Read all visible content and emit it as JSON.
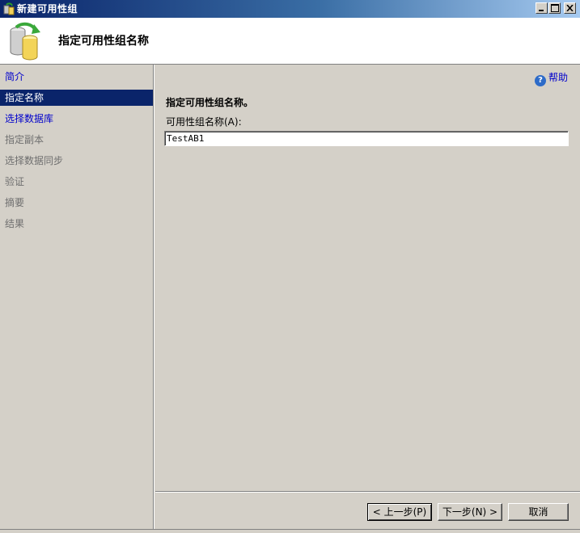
{
  "window": {
    "title": "新建可用性组"
  },
  "header": {
    "title": "指定可用性组名称"
  },
  "sidebar": {
    "items": [
      {
        "label": "简介",
        "state": "link"
      },
      {
        "label": "指定名称",
        "state": "selected"
      },
      {
        "label": "选择数据库",
        "state": "link"
      },
      {
        "label": "指定副本",
        "state": "disabled"
      },
      {
        "label": "选择数据同步",
        "state": "disabled"
      },
      {
        "label": "验证",
        "state": "disabled"
      },
      {
        "label": "摘要",
        "state": "disabled"
      },
      {
        "label": "结果",
        "state": "disabled"
      }
    ]
  },
  "main": {
    "help_label": "帮助",
    "section_title": "指定可用性组名称。",
    "field_label": "可用性组名称(A):",
    "field_value": "TestAB1"
  },
  "buttons": {
    "prev": "< 上一步(P)",
    "next": "下一步(N) >",
    "cancel": "取消"
  },
  "colors": {
    "selected_bg": "#0a246a",
    "link": "#0000cc",
    "disabled": "#6f6f6f"
  }
}
